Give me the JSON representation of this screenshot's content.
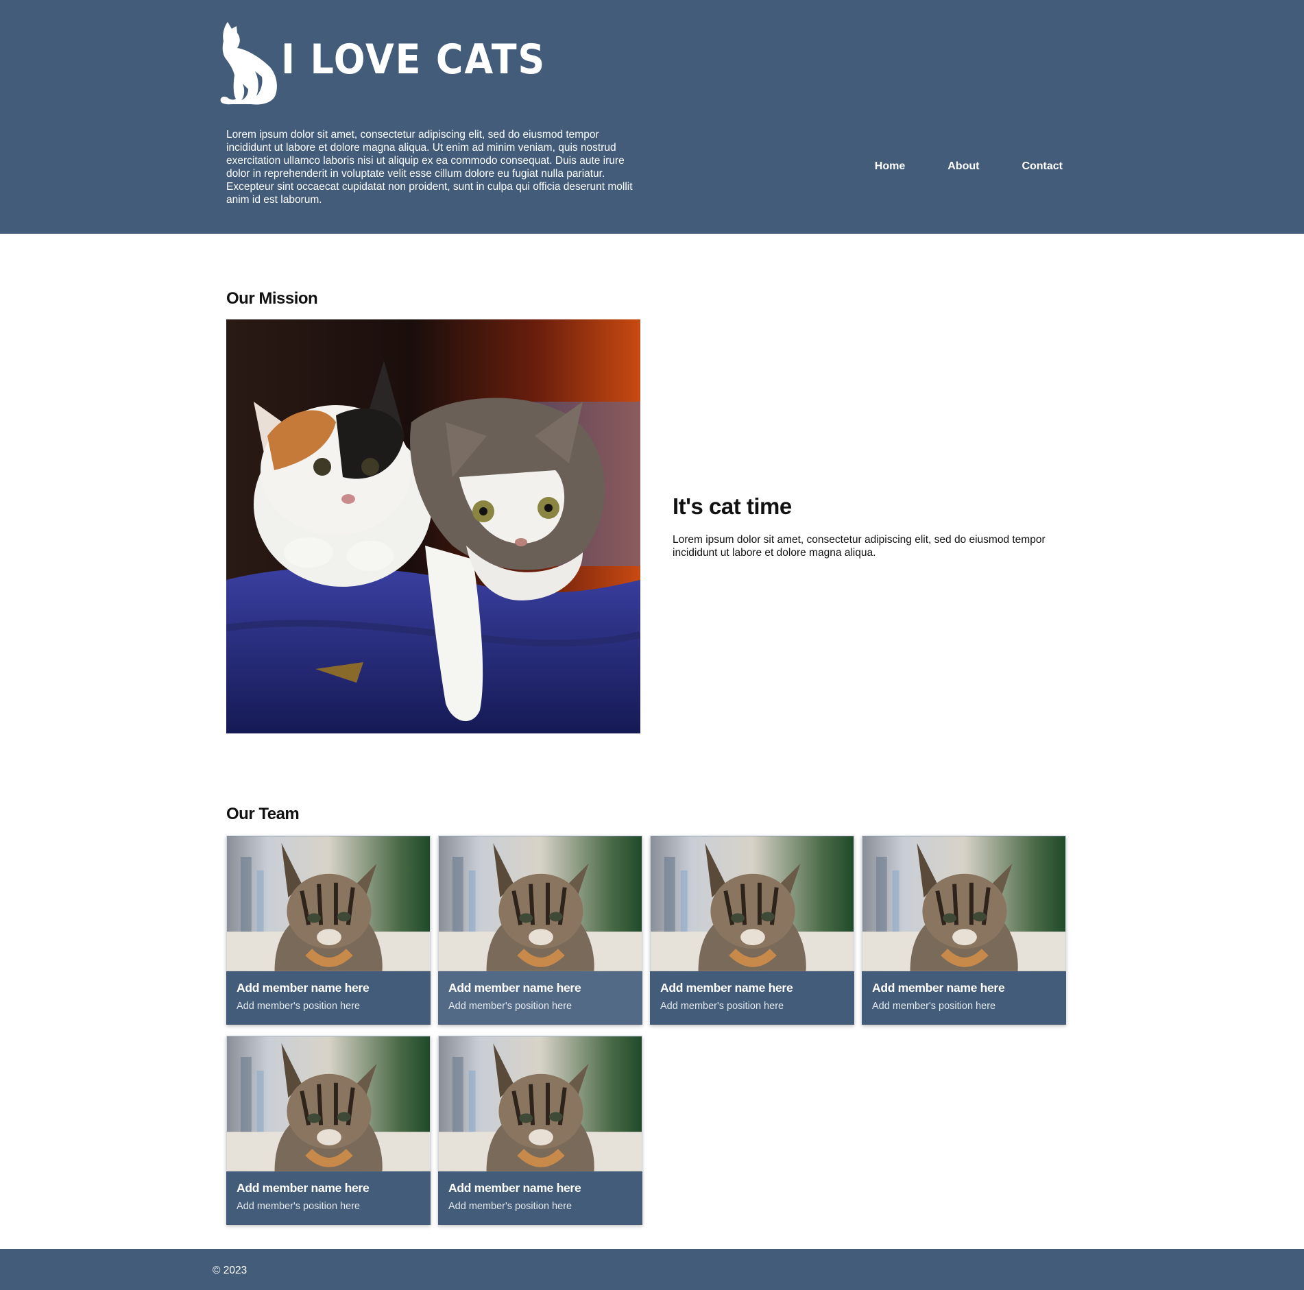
{
  "header": {
    "logo_text": "I LOVE CATS",
    "intro": "Lorem ipsum dolor sit amet, consectetur adipiscing elit, sed do eiusmod tempor incididunt ut labore et dolore magna aliqua. Ut enim ad minim veniam, quis nostrud exercitation ullamco laboris nisi ut aliquip ex ea commodo consequat. Duis aute irure dolor in reprehenderit in voluptate velit esse cillum dolore eu fugiat nulla pariatur. Excepteur sint occaecat cupidatat non proident, sunt in culpa qui officia deserunt mollit anim id est laborum.",
    "nav": [
      "Home",
      "About",
      "Contact"
    ]
  },
  "mission": {
    "title": "Our Mission",
    "heading": "It's cat time",
    "text": "Lorem ipsum dolor sit amet, consectetur adipiscing elit, sed do eiusmod tempor incididunt ut labore et dolore magna aliqua."
  },
  "team": {
    "title": "Our Team",
    "members": [
      {
        "name": "Add member name here",
        "position": "Add member's position here"
      },
      {
        "name": "Add member name here",
        "position": "Add member's position here"
      },
      {
        "name": "Add member name here",
        "position": "Add member's position here"
      },
      {
        "name": "Add member name here",
        "position": "Add member's position here"
      },
      {
        "name": "Add member name here",
        "position": "Add member's position here"
      },
      {
        "name": "Add member name here",
        "position": "Add member's position here"
      }
    ]
  },
  "footer": {
    "copyright": "© 2023"
  },
  "colors": {
    "header_bg": "#425c79",
    "card_hover_bg": "#536a87",
    "text_light": "#ffffff"
  },
  "icons": [
    "cat-silhouette-icon"
  ]
}
